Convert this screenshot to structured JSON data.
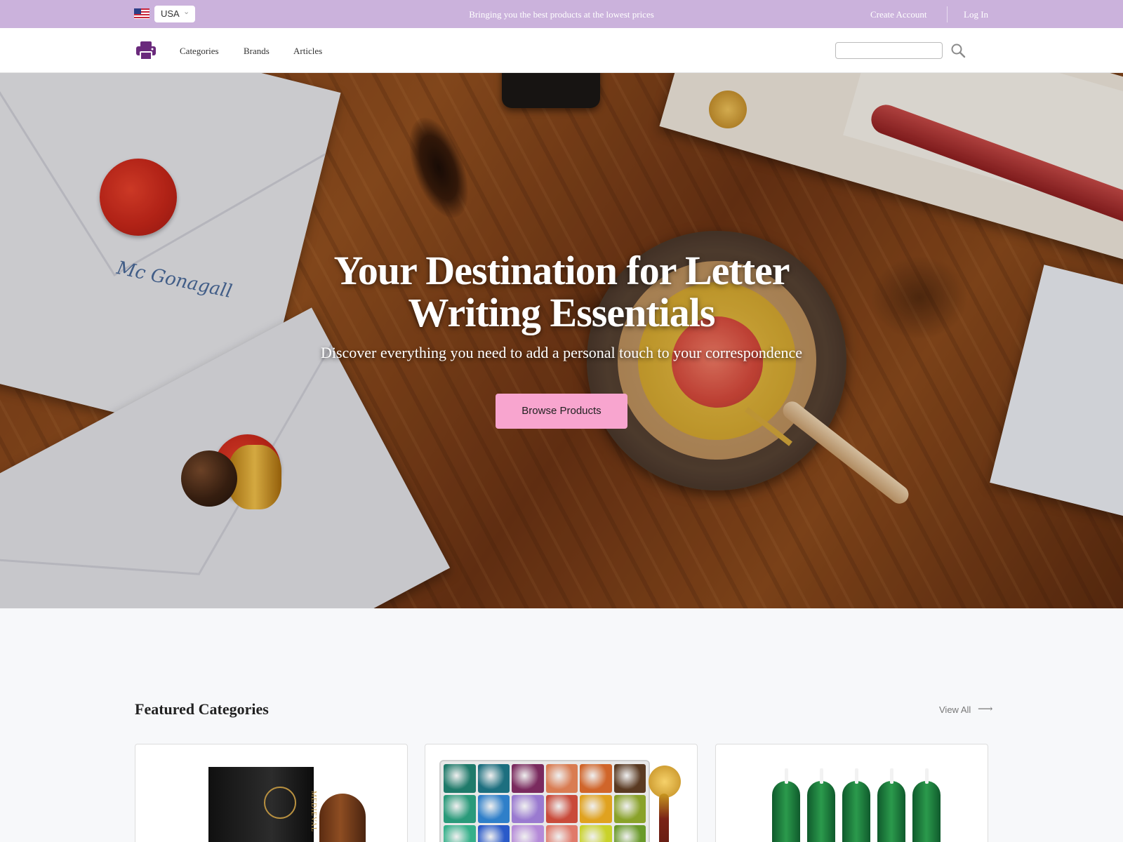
{
  "topbar": {
    "country": "USA",
    "promo": "Bringing you the best products at the lowest prices",
    "create_account": "Create Account",
    "log_in": "Log In",
    "colors": {
      "background": "#cbb2dc"
    }
  },
  "nav": {
    "logo_icon": "printer-icon",
    "items": [
      {
        "label": "Categories"
      },
      {
        "label": "Brands"
      },
      {
        "label": "Articles"
      }
    ],
    "search": {
      "placeholder": "",
      "value": "",
      "icon": "search-icon"
    }
  },
  "hero": {
    "title_lines": [
      "Your Destination for Letter",
      "Writing Essentials"
    ],
    "subtitle": "Discover everything you need to add a personal touch to your correspondence",
    "cta": "Browse Products",
    "handwriting": "Mc Gonagall",
    "colors": {
      "cta": "#f8a5cf"
    }
  },
  "featured": {
    "title": "Featured Categories",
    "view_all": "View All",
    "view_all_icon": "arrow-right-icon",
    "cards": [
      {
        "image": "wax-seal-stamp-kit",
        "box_brand": "MEDIEVAL"
      },
      {
        "image": "sealing-wax-beads-set"
      },
      {
        "image": "green-wax-sticks"
      }
    ]
  }
}
